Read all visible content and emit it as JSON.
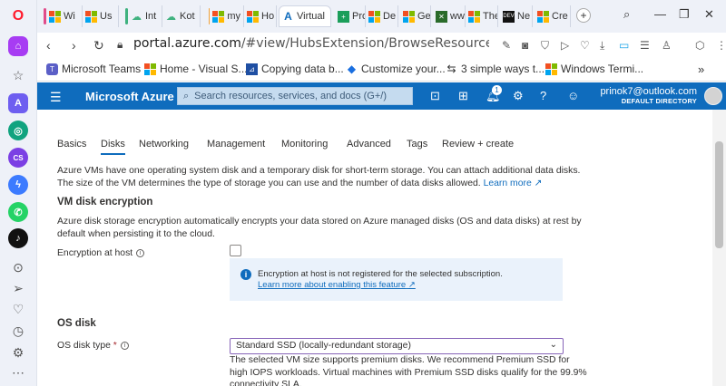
{
  "browser": {
    "tabs": [
      {
        "label": "Wi"
      },
      {
        "label": "Us"
      },
      {
        "label": "Int"
      },
      {
        "label": "Kot"
      },
      {
        "label": "my"
      },
      {
        "label": "Ho"
      },
      {
        "label": "Virtual"
      },
      {
        "label": "Pro"
      },
      {
        "label": "De"
      },
      {
        "label": "Ge"
      },
      {
        "label": "ww"
      },
      {
        "label": "The"
      },
      {
        "label": "Ne"
      },
      {
        "label": "Cre"
      }
    ],
    "url_host": "portal.azure.com",
    "url_path": "/#view/HubsExtension/BrowseResource/resourceType/M",
    "bookmarks": [
      {
        "label": "Microsoft Teams"
      },
      {
        "label": "Home - Visual S..."
      },
      {
        "label": "Copying data b..."
      },
      {
        "label": "Customize your..."
      },
      {
        "label": "3 simple ways t..."
      },
      {
        "label": "Windows Termi..."
      }
    ]
  },
  "azure": {
    "brand": "Microsoft Azure",
    "search_placeholder": "Search resources, services, and docs (G+/)",
    "notification_count": "1",
    "user_email": "prinok7@outlook.com",
    "user_directory": "DEFAULT DIRECTORY"
  },
  "wizard": {
    "tabs": [
      {
        "label": "Basics"
      },
      {
        "label": "Disks"
      },
      {
        "label": "Networking"
      },
      {
        "label": "Management"
      },
      {
        "label": "Monitoring"
      },
      {
        "label": "Advanced"
      },
      {
        "label": "Tags"
      },
      {
        "label": "Review + create"
      }
    ],
    "selected_tab": "Disks",
    "intro_line1": "Azure VMs have one operating system disk and a temporary disk for short-term storage. You can attach additional data disks.",
    "intro_line2": "The size of the VM determines the type of storage you can use and the number of data disks allowed.",
    "learn_more": "Learn more",
    "encryption_heading": "VM disk encryption",
    "encryption_desc1": "Azure disk storage encryption automatically encrypts your data stored on Azure managed disks (OS and data disks) at rest by",
    "encryption_desc2": "default when persisting it to the cloud.",
    "encryption_at_host_label": "Encryption at host",
    "encryption_at_host_checked": false,
    "info_text": "Encryption at host is not registered for the selected subscription.",
    "info_link": "Learn more about enabling this feature",
    "os_disk_heading": "OS disk",
    "os_disk_type_label": "OS disk type",
    "required_marker": "*",
    "os_disk_type_value": "Standard SSD (locally-redundant storage)",
    "premium_note1": "The selected VM size supports premium disks. We recommend Premium SSD for",
    "premium_note2": "high IOPS workloads. Virtual machines with Premium SSD disks qualify for the 99.9%",
    "premium_note3": "connectivity SLA."
  },
  "colors": {
    "azure_blue": "#0f6cbd",
    "opera_red": "#ff1b2d",
    "select_border": "#8764b8"
  }
}
